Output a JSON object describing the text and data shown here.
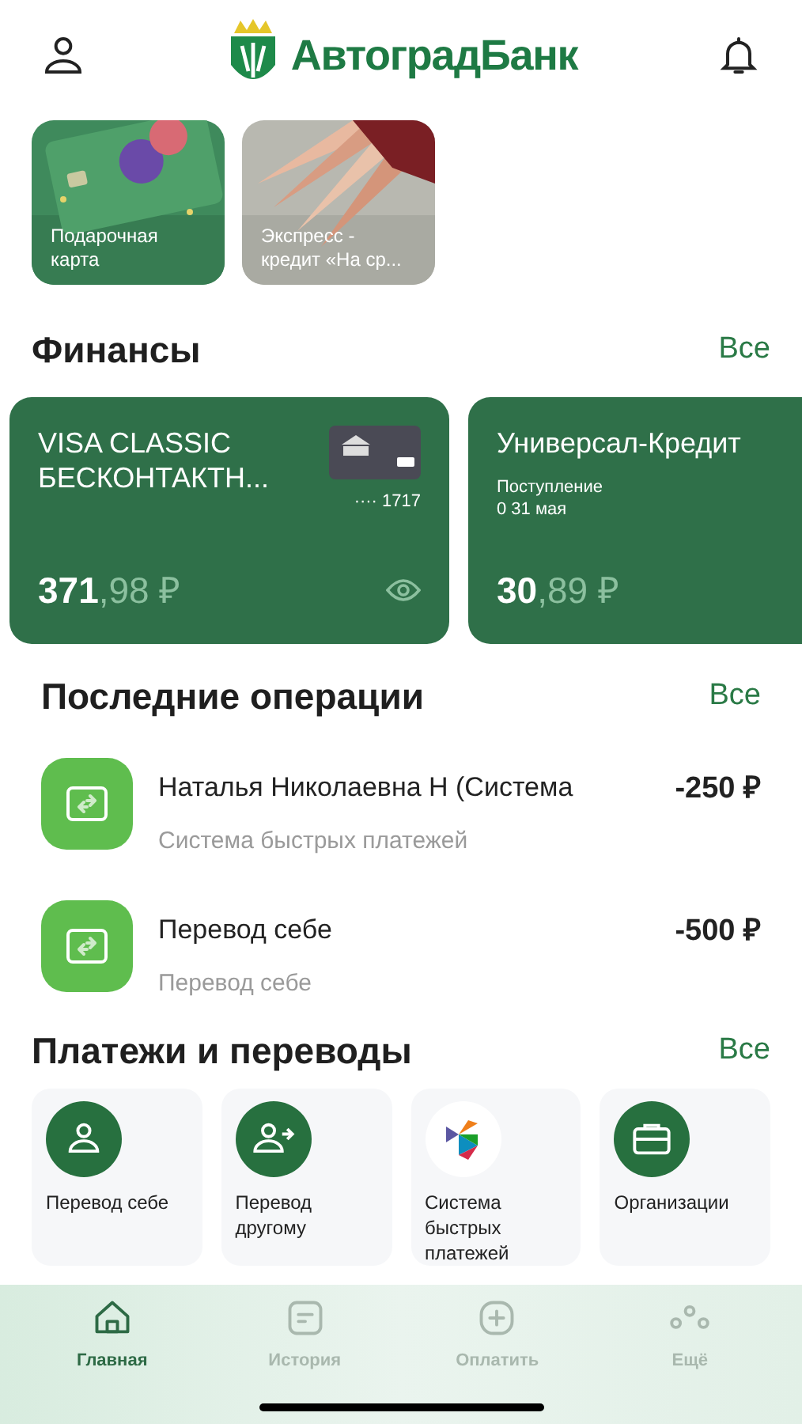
{
  "header": {
    "logo_text": "АвтоградБанк"
  },
  "stories": [
    {
      "kind": "picture",
      "title": "Подарочная карта"
    },
    {
      "kind": "picture",
      "title": "Экспресс - кредит «На ср..."
    }
  ],
  "finances": {
    "title": "Финансы",
    "all_link": "Все",
    "accounts": [
      {
        "kind": "card",
        "name": "VISA CLASSIC БЕСКОНТАКТН...",
        "card_number": "···· 1717",
        "amount_main": "371",
        "amount_fraction": ",98 ₽"
      },
      {
        "kind": "loan",
        "name": "Универсал-Кредит",
        "note": "Поступление",
        "date": "0 31 мая",
        "amount_main": "30",
        "amount_fraction": ",89 ₽"
      }
    ]
  },
  "operations": {
    "title": "Последние операции",
    "all_link": "Все",
    "items": [
      {
        "title": "Наталья Николаевна Н (Система",
        "subtitle": "Система быстрых платежей",
        "amount": "-250 ₽"
      },
      {
        "title": "Перевод себе",
        "subtitle": "Перевод себе",
        "amount": "-500 ₽"
      }
    ]
  },
  "payments": {
    "title": "Платежи и переводы",
    "all_link": "Все",
    "items": [
      {
        "kind": "self",
        "label": "Перевод себе"
      },
      {
        "kind": "other",
        "label": "Перевод другому"
      },
      {
        "kind": "sbp",
        "label": "Система быстрых платежей"
      },
      {
        "kind": "org",
        "label": "Организации"
      }
    ]
  },
  "nav": [
    {
      "kind": "home",
      "label": "Главная",
      "selected": true
    },
    {
      "kind": "history",
      "label": "История",
      "selected": false
    },
    {
      "kind": "pay",
      "label": "Оплатить",
      "selected": false
    },
    {
      "kind": "more",
      "label": "Ещё",
      "selected": false
    }
  ]
}
